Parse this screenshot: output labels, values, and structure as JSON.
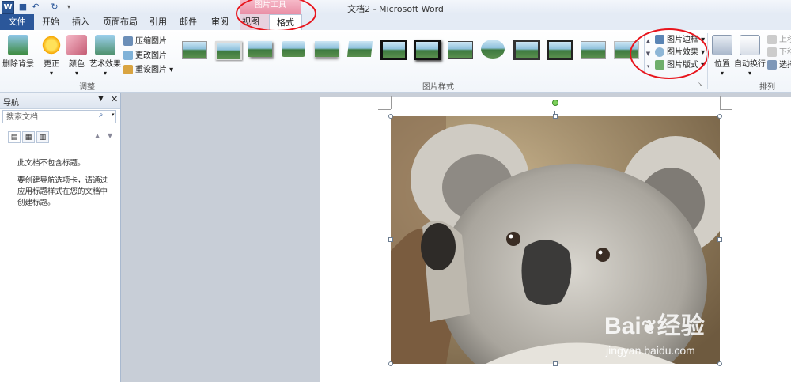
{
  "window": {
    "title": "文档2 - Microsoft Word"
  },
  "quick_access": [
    "word-logo",
    "save-icon",
    "undo-icon",
    "redo-icon",
    "customize-icon"
  ],
  "contextual": {
    "header": "图片工具"
  },
  "tabs": [
    "文件",
    "开始",
    "插入",
    "页面布局",
    "引用",
    "邮件",
    "审阅",
    "视图",
    "格式"
  ],
  "ribbon": {
    "adjust": {
      "label": "调整",
      "remove_bg": "删除背景",
      "correct": "更正",
      "color": "颜色",
      "art_effects": "艺术效果",
      "compress": "压缩图片",
      "change": "更改图片",
      "reset": "重设图片"
    },
    "styles": {
      "label": "图片样式",
      "border": "图片边框",
      "effects": "图片效果",
      "layout": "图片版式"
    },
    "arrange": {
      "label": "排列",
      "position": "位置",
      "wrap": "自动换行",
      "forward": "上移",
      "backward": "下移",
      "select": "选择"
    }
  },
  "nav": {
    "title": "导航",
    "search_placeholder": "搜索文档",
    "message1": "此文档不包含标题。",
    "message2": "要创建导航选项卡，请通过应用标题样式在您的文档中创建标题。"
  },
  "watermark": {
    "brand": "Bai",
    "brand2": "经验",
    "url": "jingyan.baidu.com"
  },
  "colors": {
    "file_tab": "#2b579a",
    "context": "#e88aa2",
    "annotation": "#e8141c"
  }
}
